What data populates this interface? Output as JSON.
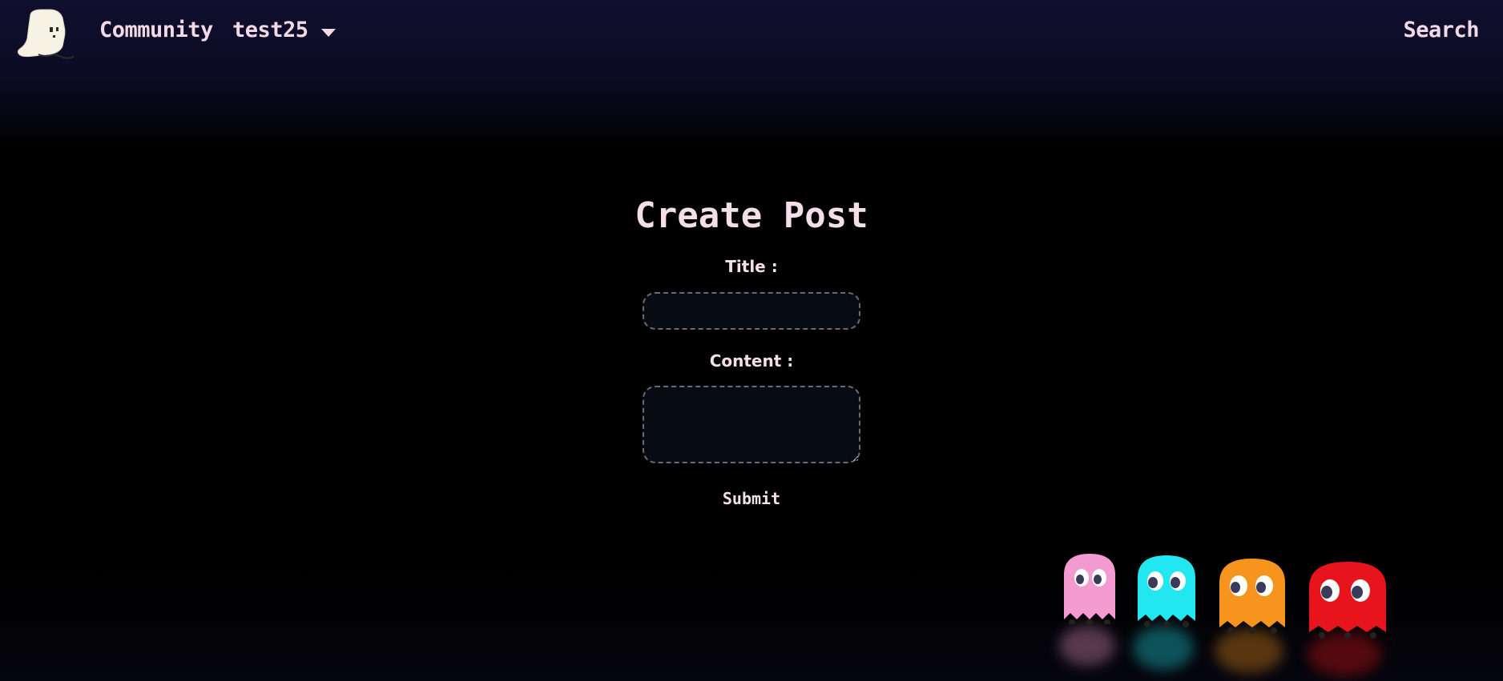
{
  "navbar": {
    "logo_icon": "ghost-logo-icon",
    "community_label": "Community",
    "user_label": "test25",
    "user_menu_icon": "chevron-down-icon",
    "search_label": "Search"
  },
  "form": {
    "heading": "Create Post",
    "title_label": "Title :",
    "title_value": "",
    "content_label": "Content :",
    "content_value": "",
    "submit_label": "Submit"
  },
  "decoration": {
    "ghosts": [
      {
        "name": "pink-ghost-icon",
        "color": "#f39bd0"
      },
      {
        "name": "cyan-ghost-icon",
        "color": "#22e6f0"
      },
      {
        "name": "orange-ghost-icon",
        "color": "#f7941d"
      },
      {
        "name": "red-ghost-icon",
        "color": "#e8141b"
      }
    ]
  },
  "colors": {
    "text": "#f3dfe8",
    "input_bg": "#070b14",
    "input_border": "#6a6a72",
    "header_bg": "#0f0f2e"
  }
}
